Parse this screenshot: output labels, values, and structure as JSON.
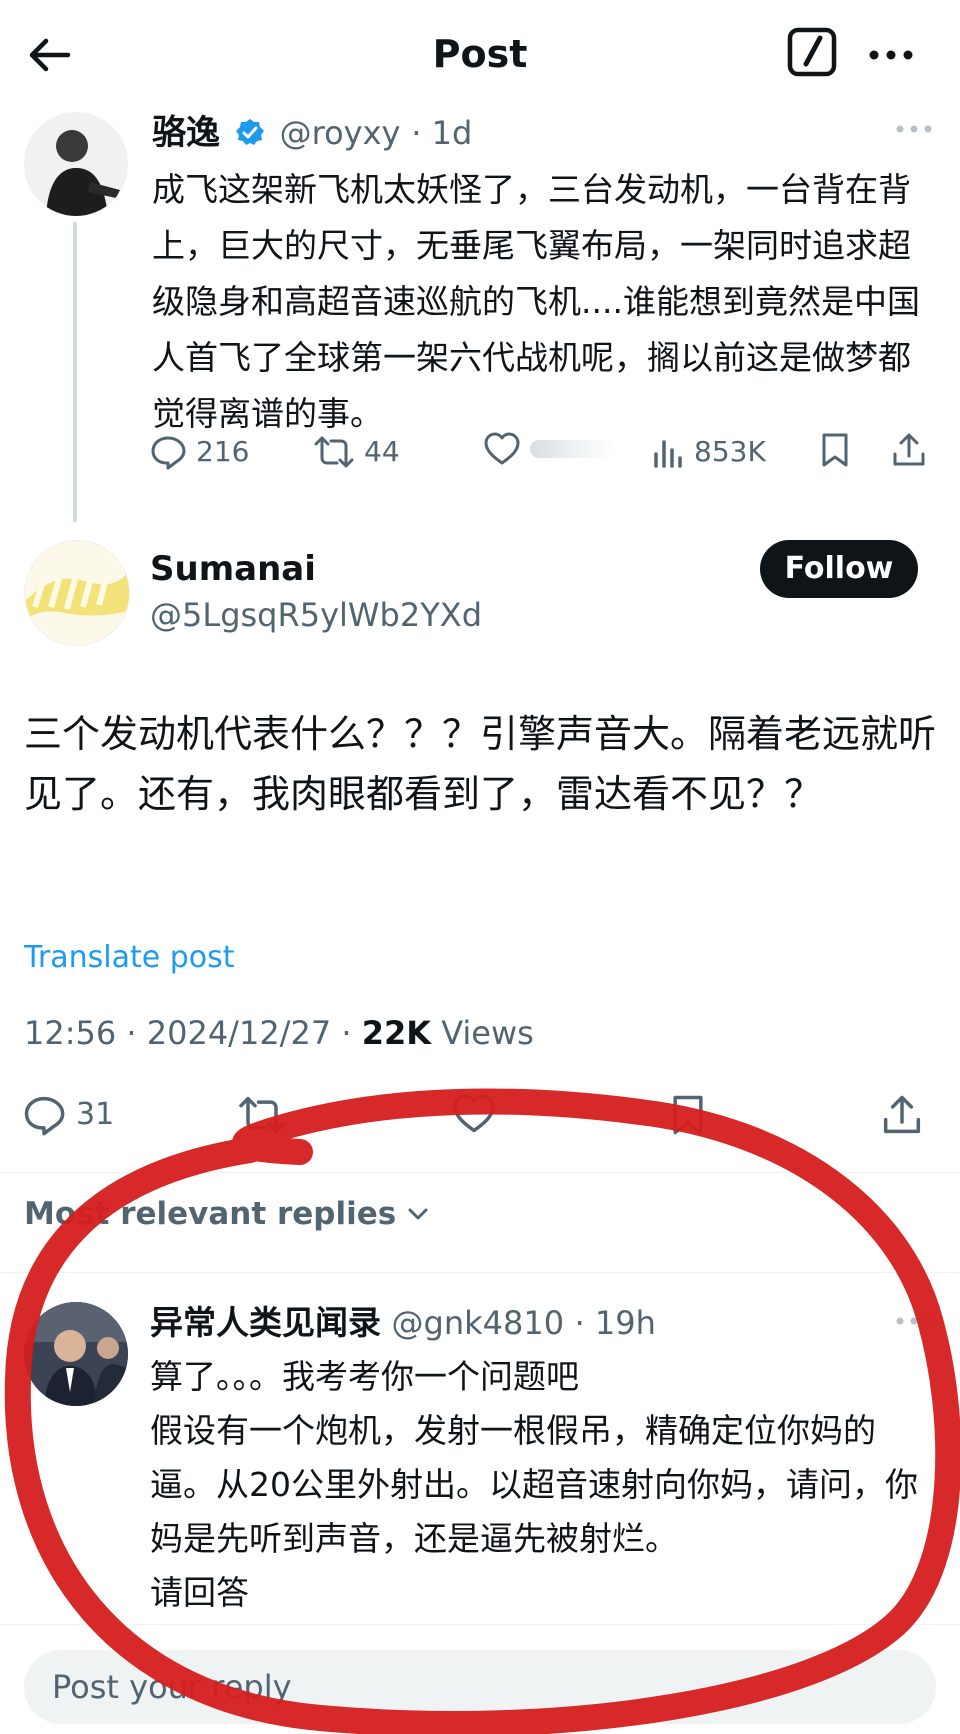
{
  "header": {
    "title": "Post"
  },
  "original_post": {
    "display_name": "骆逸",
    "handle": "@royxy",
    "time": "· 1d",
    "text": "成飞这架新飞机太妖怪了，三台发动机，一台背在背上，巨大的尺寸，无垂尾飞翼布局，一架同时追求超级隐身和高超音速巡航的飞机....谁能想到竟然是中国人首飞了全球第一架六代战机呢，搁以前这是做梦都觉得离谱的事。",
    "replies": "216",
    "reposts": "44",
    "views": "853K"
  },
  "main_post": {
    "display_name": "Sumanai",
    "handle": "@5LgsqR5ylWb2YXd",
    "follow_label": "Follow",
    "text": "三个发动机代表什么？？？引擎声音大。隔着老远就听见了。还有，我肉眼都看到了，雷达看不见？？",
    "translate_label": "Translate post",
    "timestamp": "12:56 · 2024/12/27 · ",
    "views_count": "22K",
    "views_label": " Views",
    "replies": "31"
  },
  "replies_section": {
    "sort_label": "Most relevant replies"
  },
  "reply": {
    "display_name": "异常人类见闻录",
    "handle": "@gnk4810",
    "time": "· 19h",
    "text": "算了。。。我考考你一个问题吧\n假设有一个炮机，发射一根假吊，精确定位你妈的逼。从20公里外射出。以超音速射向你妈，请问，你妈是先听到声音，还是逼先被射烂。\n请回答"
  },
  "composer": {
    "placeholder": "Post your reply"
  },
  "colors": {
    "accent": "#1d9bf0",
    "text": "#0f1419",
    "muted": "#536471",
    "marker": "#d51d1d"
  },
  "icons": [
    "back-arrow-icon",
    "compose-icon",
    "more-icon",
    "verified-icon",
    "reply-icon",
    "repost-icon",
    "like-icon",
    "views-icon",
    "bookmark-icon",
    "share-icon",
    "chevron-down-icon"
  ]
}
